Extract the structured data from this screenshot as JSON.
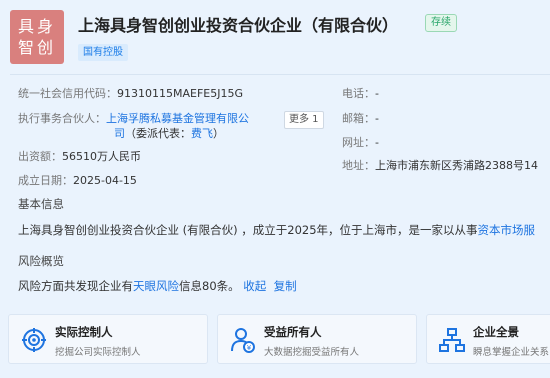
{
  "logo": {
    "line1": "具身",
    "line2": "智创"
  },
  "company": {
    "name": "上海具身智创创业投资合伙企业（有限合伙）",
    "status": "存续",
    "tag": "国有控股"
  },
  "left_info": {
    "credit_code_label": "统一社会信用代码：",
    "credit_code": "91310115MAEFE5J15G",
    "partner_label": "执行事务合伙人：",
    "partner_link_line1": "上海孚腾私募基金管理有限公",
    "partner_link_line2": "司",
    "rep_label": "（委派代表：",
    "rep_name": "费飞",
    "rep_close": "）",
    "more_label": "更多 1",
    "capital_label": "出资额：",
    "capital": "56510万人民币",
    "date_label": "成立日期：",
    "date": "2025-04-15"
  },
  "right_info": {
    "phone_label": "电话：",
    "phone": "-",
    "email_label": "邮箱：",
    "email": "-",
    "website_label": "网址：",
    "website": "-",
    "address_label": "地址：",
    "address": "上海市浦东新区秀浦路2388号14"
  },
  "basic": {
    "title": "基本信息",
    "text_before": "上海具身智创创业投资合伙企业 (有限合伙) ，成立于2025年，位于上海市，是一家以从事",
    "link": "资本市场服"
  },
  "risk": {
    "title": "风险概览",
    "text_before": "风险方面共发现企业有",
    "link": "天眼风险",
    "text_after": "信息80条。",
    "collapse": "收起",
    "copy": "复制"
  },
  "cards": [
    {
      "title": "实际控制人",
      "subtitle": "挖掘公司实际控制人",
      "icon": "target-icon"
    },
    {
      "title": "受益所有人",
      "subtitle": "大数据挖掘受益所有人",
      "icon": "beneficiary-icon"
    },
    {
      "title": "企业全景",
      "subtitle": "瞬息掌握企业关系",
      "icon": "network-icon"
    }
  ],
  "colors": {
    "logo_bg": "#d9807e",
    "link": "#1e74e0",
    "status_green": "#29a56a",
    "page_bg": "#eaf3fd"
  }
}
